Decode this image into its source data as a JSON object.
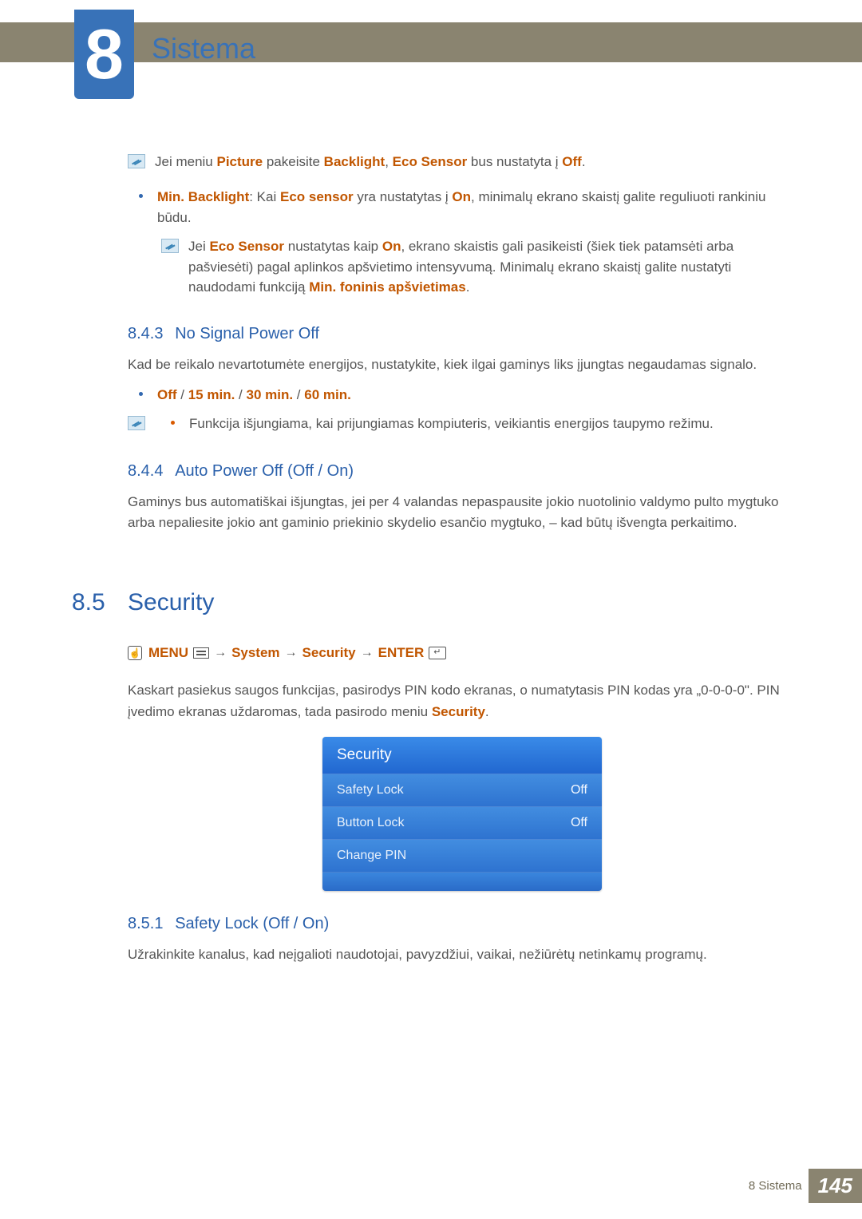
{
  "chapter": {
    "number": "8",
    "title": "Sistema"
  },
  "note1": {
    "pre": "Jei meniu ",
    "k1": "Picture",
    "mid1": " pakeisite ",
    "k2": "Backlight",
    "sep": ", ",
    "k3": "Eco Sensor",
    "mid2": " bus nustatyta į ",
    "k4": "Off",
    "end": "."
  },
  "bullet1": {
    "k1": "Min. Backlight",
    "t1": ": Kai ",
    "k2": "Eco sensor",
    "t2": " yra nustatytas į ",
    "k3": "On",
    "t3": ", minimalų ekrano skaistį galite reguliuoti rankiniu būdu."
  },
  "note2": {
    "t1": "Jei ",
    "k1": "Eco Sensor",
    "t2": " nustatytas kaip ",
    "k2": "On",
    "t3": ", ekrano skaistis gali pasikeisti (šiek tiek patamsėti arba pašviesėti) pagal aplinkos apšvietimo intensyvumą. Minimalų ekrano skaistį galite nustatyti naudodami funkciją ",
    "k3": "Min. foninis apšvietimas",
    "t4": "."
  },
  "sec843": {
    "num": "8.4.3",
    "title": "No Signal Power Off"
  },
  "para843": "Kad be reikalo nevartotumėte energijos, nustatykite, kiek ilgai gaminys liks įjungtas negaudamas signalo.",
  "bullet843": {
    "o1": "Off",
    "s1": " / ",
    "o2": "15 min.",
    "s2": " / ",
    "o3": "30 min.",
    "s3": " / ",
    "o4": "60 min."
  },
  "note843": "Funkcija išjungiama, kai prijungiamas kompiuteris, veikiantis energijos taupymo režimu.",
  "sec844": {
    "num": "8.4.4",
    "title": "Auto Power Off (Off / On)"
  },
  "para844": "Gaminys bus automatiškai išjungtas, jei per 4 valandas nepaspausite jokio nuotolinio valdymo pulto mygtuko arba nepaliesite jokio ant gaminio priekinio skydelio esančio mygtuko, – kad būtų išvengta perkaitimo.",
  "sec85": {
    "num": "8.5",
    "title": "Security"
  },
  "menupath": {
    "menu": "MENU",
    "a1": "→",
    "system": "System",
    "a2": "→",
    "security": "Security",
    "a3": "→",
    "enter": "ENTER"
  },
  "para85": {
    "t1": "Kaskart pasiekus saugos funkcijas, pasirodys PIN kodo ekranas, o numatytasis PIN kodas yra „0-0-0-0\". PIN įvedimo ekranas uždaromas, tada pasirodo meniu ",
    "k1": "Security",
    "t2": "."
  },
  "panel": {
    "header": "Security",
    "rows": [
      {
        "label": "Safety Lock",
        "value": "Off"
      },
      {
        "label": "Button Lock",
        "value": "Off"
      },
      {
        "label": "Change PIN",
        "value": ""
      }
    ]
  },
  "sec851": {
    "num": "8.5.1",
    "title": "Safety Lock (Off / On)"
  },
  "para851": "Užrakinkite kanalus, kad neįgalioti naudotojai, pavyzdžiui, vaikai, nežiūrėtų netinkamų programų.",
  "footer": {
    "text": "8 Sistema",
    "page": "145"
  }
}
